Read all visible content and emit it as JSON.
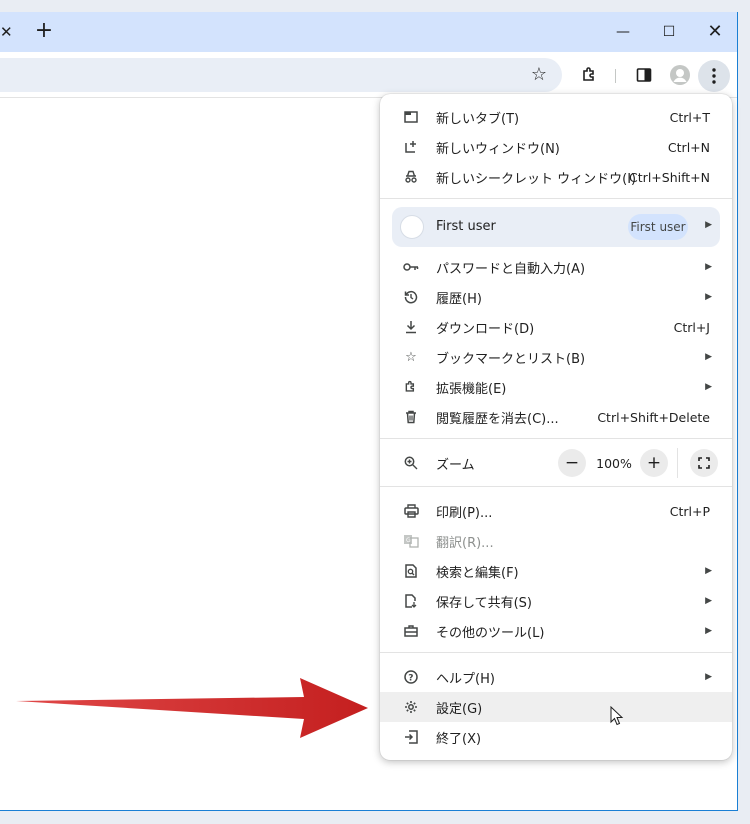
{
  "browser": {
    "tab_close_glyph": "✕",
    "new_tab_glyph": "+",
    "window": {
      "minimize": "—",
      "maximize": "☐",
      "close": "✕"
    }
  },
  "menu": {
    "group1": [
      {
        "label": "新しいタブ(T)",
        "shortcut": "Ctrl+T",
        "icon": "new-tab-icon"
      },
      {
        "label": "新しいウィンドウ(N)",
        "shortcut": "Ctrl+N",
        "icon": "new-window-icon"
      },
      {
        "label": "新しいシークレット ウィンドウ(I)",
        "shortcut": "Ctrl+Shift+N",
        "icon": "incognito-icon"
      }
    ],
    "profile": {
      "name": "First user",
      "badge": "First user"
    },
    "group2": [
      {
        "label": "パスワードと自動入力(A)",
        "shortcut": "",
        "icon": "key-icon",
        "submenu": true
      },
      {
        "label": "履歴(H)",
        "shortcut": "",
        "icon": "history-icon",
        "submenu": true
      },
      {
        "label": "ダウンロード(D)",
        "shortcut": "Ctrl+J",
        "icon": "download-icon"
      },
      {
        "label": "ブックマークとリスト(B)",
        "shortcut": "",
        "icon": "star-icon",
        "submenu": true
      },
      {
        "label": "拡張機能(E)",
        "shortcut": "",
        "icon": "extension-icon",
        "submenu": true
      },
      {
        "label": "閲覧履歴を消去(C)...",
        "shortcut": "Ctrl+Shift+Delete",
        "icon": "trash-icon"
      }
    ],
    "zoom": {
      "label": "ズーム",
      "value": "100%",
      "minus": "−",
      "plus": "+"
    },
    "group3": [
      {
        "label": "印刷(P)...",
        "shortcut": "Ctrl+P",
        "icon": "print-icon"
      },
      {
        "label": "翻訳(R)...",
        "shortcut": "",
        "icon": "translate-icon",
        "disabled": true
      },
      {
        "label": "検索と編集(F)",
        "shortcut": "",
        "icon": "find-icon",
        "submenu": true
      },
      {
        "label": "保存して共有(S)",
        "shortcut": "",
        "icon": "save-share-icon",
        "submenu": true
      },
      {
        "label": "その他のツール(L)",
        "shortcut": "",
        "icon": "toolbox-icon",
        "submenu": true
      }
    ],
    "group4": [
      {
        "label": "ヘルプ(H)",
        "shortcut": "",
        "icon": "help-icon",
        "submenu": true
      },
      {
        "label": "設定(G)",
        "shortcut": "",
        "icon": "gear-icon",
        "hover": true
      },
      {
        "label": "終了(X)",
        "shortcut": "",
        "icon": "exit-icon"
      }
    ]
  },
  "colors": {
    "accent": "#d3e3fd",
    "annotation_arrow": "#d62c2c"
  }
}
